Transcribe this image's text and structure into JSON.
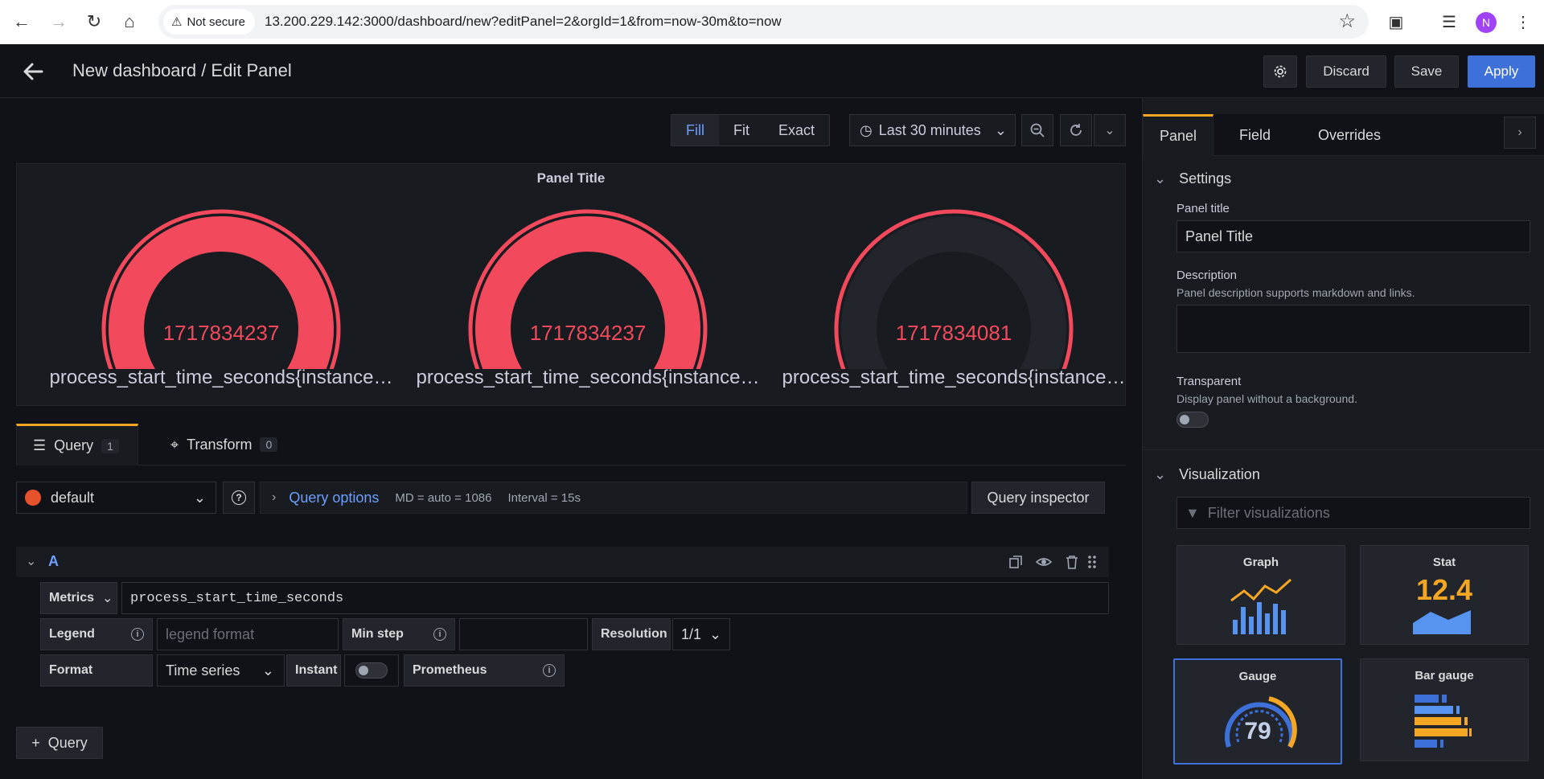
{
  "browser": {
    "security_label": "Not secure",
    "url": "13.200.229.142:3000/dashboard/new?editPanel=2&orgId=1&from=now-30m&to=now",
    "profile_initial": "N"
  },
  "header": {
    "title": "New dashboard / Edit Panel",
    "discard_label": "Discard",
    "save_label": "Save",
    "apply_label": "Apply"
  },
  "viz_toolbar": {
    "modes": [
      "Fill",
      "Fit",
      "Exact"
    ],
    "active_mode": "Fill",
    "time_range": "Last 30 minutes"
  },
  "panel": {
    "title": "Panel Title",
    "gauges": [
      {
        "value": "1717834237",
        "label": "process_start_time_seconds{instance…",
        "fill": 1.0
      },
      {
        "value": "1717834237",
        "label": "process_start_time_seconds{instance…",
        "fill": 1.0
      },
      {
        "value": "1717834081",
        "label": "process_start_time_seconds{instance…",
        "fill": 0.0
      }
    ],
    "colors": {
      "threshold": "#f2495c",
      "track": "#22252b"
    }
  },
  "query_tabs": [
    {
      "label": "Query",
      "count": "1"
    },
    {
      "label": "Transform",
      "count": "0"
    }
  ],
  "datasource": {
    "name": "default",
    "options_label": "Query options",
    "md": "MD = auto = 1086",
    "interval": "Interval = 15s",
    "inspector_label": "Query inspector"
  },
  "query": {
    "ref": "A",
    "metrics_label": "Metrics",
    "metrics_value": "process_start_time_seconds",
    "legend_label": "Legend",
    "legend_placeholder": "legend format",
    "min_step_label": "Min step",
    "resolution_label": "Resolution",
    "resolution_value": "1/1",
    "format_label": "Format",
    "format_value": "Time series",
    "instant_label": "Instant",
    "prometheus_label": "Prometheus",
    "add_query_label": "Query"
  },
  "options_pane": {
    "tabs": [
      "Panel",
      "Field",
      "Overrides"
    ],
    "settings_title": "Settings",
    "panel_title_label": "Panel title",
    "panel_title_value": "Panel Title",
    "description_label": "Description",
    "description_hint": "Panel description supports markdown and links.",
    "transparent_label": "Transparent",
    "transparent_hint": "Display panel without a background.",
    "visualization_title": "Visualization",
    "filter_placeholder": "Filter visualizations",
    "viz_cards": [
      {
        "name": "Graph"
      },
      {
        "name": "Stat",
        "sample": "12.4"
      },
      {
        "name": "Gauge",
        "sample": "79"
      },
      {
        "name": "Bar gauge"
      }
    ]
  }
}
